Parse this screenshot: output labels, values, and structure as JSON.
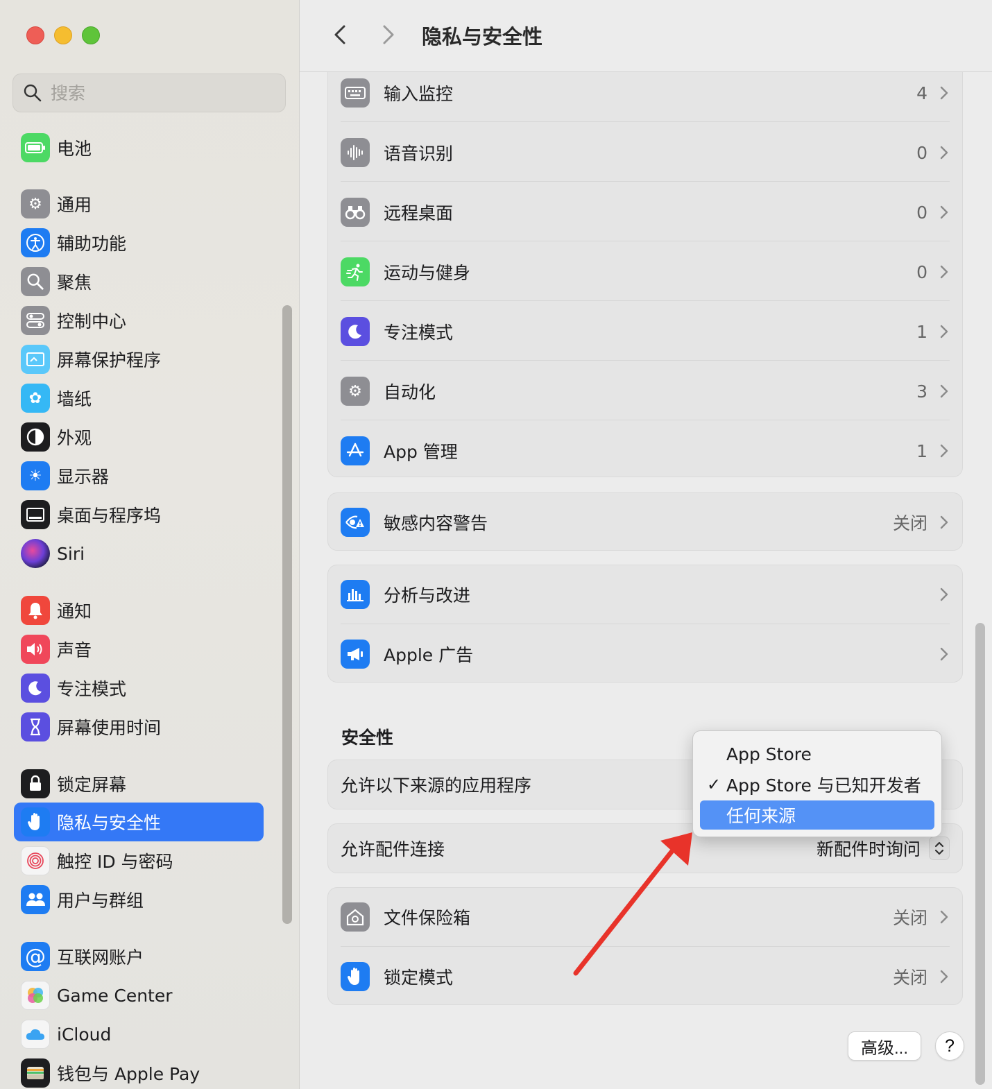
{
  "search": {
    "placeholder": "搜索"
  },
  "sidebar": {
    "items": [
      {
        "label": "电池",
        "icon": "battery-icon",
        "color": "#4cd964"
      },
      {
        "label": "通用",
        "icon": "gear-icon",
        "color": "#8e8e93"
      },
      {
        "label": "辅助功能",
        "icon": "accessibility-icon",
        "color": "#1e7cf2"
      },
      {
        "label": "聚焦",
        "icon": "magnifier-icon",
        "color": "#8e8e93"
      },
      {
        "label": "控制中心",
        "icon": "toggles-icon",
        "color": "#8e8e93"
      },
      {
        "label": "屏幕保护程序",
        "icon": "screensaver-icon",
        "color": "#5ac8fa"
      },
      {
        "label": "墙纸",
        "icon": "flower-icon",
        "color": "#35b8f5"
      },
      {
        "label": "外观",
        "icon": "appearance-icon",
        "color": "#1d1d1f"
      },
      {
        "label": "显示器",
        "icon": "sun-icon",
        "color": "#1e7cf2"
      },
      {
        "label": "桌面与程序坞",
        "icon": "dock-icon",
        "color": "#1d1d1f"
      },
      {
        "label": "Siri",
        "icon": "siri-icon",
        "color": "#303050"
      },
      {
        "label": "通知",
        "icon": "bell-icon",
        "color": "#f0473c"
      },
      {
        "label": "声音",
        "icon": "speaker-icon",
        "color": "#f0475a"
      },
      {
        "label": "专注模式",
        "icon": "moon-icon",
        "color": "#5b4fe0"
      },
      {
        "label": "屏幕使用时间",
        "icon": "hourglass-icon",
        "color": "#5b4fe0"
      },
      {
        "label": "锁定屏幕",
        "icon": "lock-icon",
        "color": "#1d1d1f"
      },
      {
        "label": "隐私与安全性",
        "icon": "hand-icon",
        "color": "#1e7cf2"
      },
      {
        "label": "触控 ID 与密码",
        "icon": "fingerprint-icon",
        "color": "#f5f5f5"
      },
      {
        "label": "用户与群组",
        "icon": "users-icon",
        "color": "#1e7cf2"
      },
      {
        "label": "互联网账户",
        "icon": "at-icon",
        "color": "#1e7cf2"
      },
      {
        "label": "Game Center",
        "icon": "gamecenter-icon",
        "color": "#f5f5f5"
      },
      {
        "label": "iCloud",
        "icon": "cloud-icon",
        "color": "#f5f5f5"
      },
      {
        "label": "钱包与 Apple Pay",
        "icon": "wallet-icon",
        "color": "#1d1d1f"
      }
    ]
  },
  "toolbar": {
    "title": "隐私与安全性"
  },
  "privacy": {
    "rows": [
      {
        "label": "输入监控",
        "value": "4",
        "icon": "keyboard-icon",
        "color": "#8e8e93"
      },
      {
        "label": "语音识别",
        "value": "0",
        "icon": "waveform-icon",
        "color": "#8e8e93"
      },
      {
        "label": "远程桌面",
        "value": "0",
        "icon": "binoculars-icon",
        "color": "#8e8e93"
      },
      {
        "label": "运动与健身",
        "value": "0",
        "icon": "running-icon",
        "color": "#4cd964"
      },
      {
        "label": "专注模式",
        "value": "1",
        "icon": "moon-icon",
        "color": "#5b4fe0"
      },
      {
        "label": "自动化",
        "value": "3",
        "icon": "gears-icon",
        "color": "#8e8e93"
      },
      {
        "label": "App 管理",
        "value": "1",
        "icon": "appstore-icon",
        "color": "#1e7cf2"
      }
    ],
    "sensitive": {
      "label": "敏感内容警告",
      "value": "关闭",
      "icon": "eye-warning-icon",
      "color": "#1e7cf2"
    },
    "analytics": [
      {
        "label": "分析与改进",
        "icon": "chart-icon",
        "color": "#1e7cf2"
      },
      {
        "label": "Apple 广告",
        "icon": "megaphone-icon",
        "color": "#1e7cf2"
      }
    ]
  },
  "security": {
    "title": "安全性",
    "allow_apps_label": "允许以下来源的应用程序",
    "accessory_label": "允许配件连接",
    "accessory_value": "新配件时询问",
    "filevault": {
      "label": "文件保险箱",
      "value": "关闭",
      "icon": "house-lock-icon",
      "color": "#8e8e93"
    },
    "lockdown": {
      "label": "锁定模式",
      "value": "关闭",
      "icon": "hand-icon",
      "color": "#1e7cf2"
    }
  },
  "popup": {
    "options": [
      {
        "label": "App Store",
        "checked": false,
        "highlighted": false
      },
      {
        "label": "App Store 与已知开发者",
        "checked": true,
        "highlighted": false
      },
      {
        "label": "任何来源",
        "checked": false,
        "highlighted": true
      }
    ],
    "checkmark": "✓"
  },
  "buttons": {
    "advanced": "高级...",
    "help": "?"
  },
  "annotation": {
    "arrow_color": "#e8332a"
  }
}
